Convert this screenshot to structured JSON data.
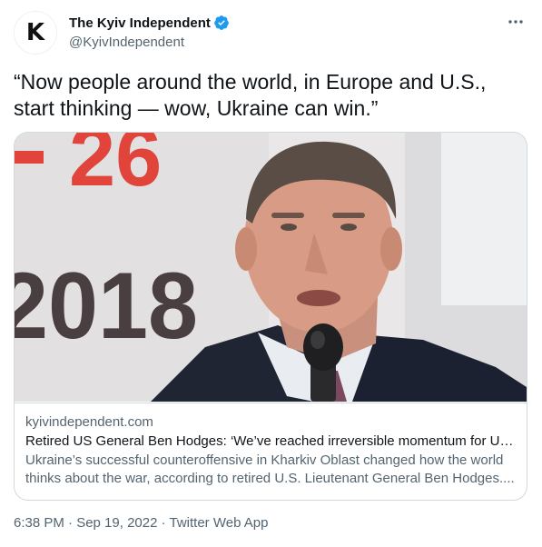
{
  "account": {
    "display_name": "The Kyiv Independent",
    "handle": "@KyivIndependent",
    "avatar_letter": "K"
  },
  "tweet": {
    "text": "“Now people around the world, in Europe and U.S., start thinking — wow, Ukraine can win.”",
    "timestamp": "6:38 PM · Sep 19, 2022 · Twitter Web App"
  },
  "card": {
    "domain": "kyivindependent.com",
    "title": "Retired US General Ben Hodges: ‘We’ve reached irreversible momentum for Uk...",
    "description": "Ukraine’s successful counteroffensive in Kharkiv Oblast changed how the world thinks about the war, according to retired U.S. Lieutenant General Ben Hodges....",
    "image_text_top": "26",
    "image_text_bottom": "2018"
  },
  "icons": {
    "verified": "verified-badge-icon",
    "more": "more-options-icon"
  },
  "colors": {
    "verified_blue": "#1d9bf0",
    "secondary_text": "#536471",
    "border": "#cfd9de",
    "backdrop_red": "#e0443a"
  }
}
